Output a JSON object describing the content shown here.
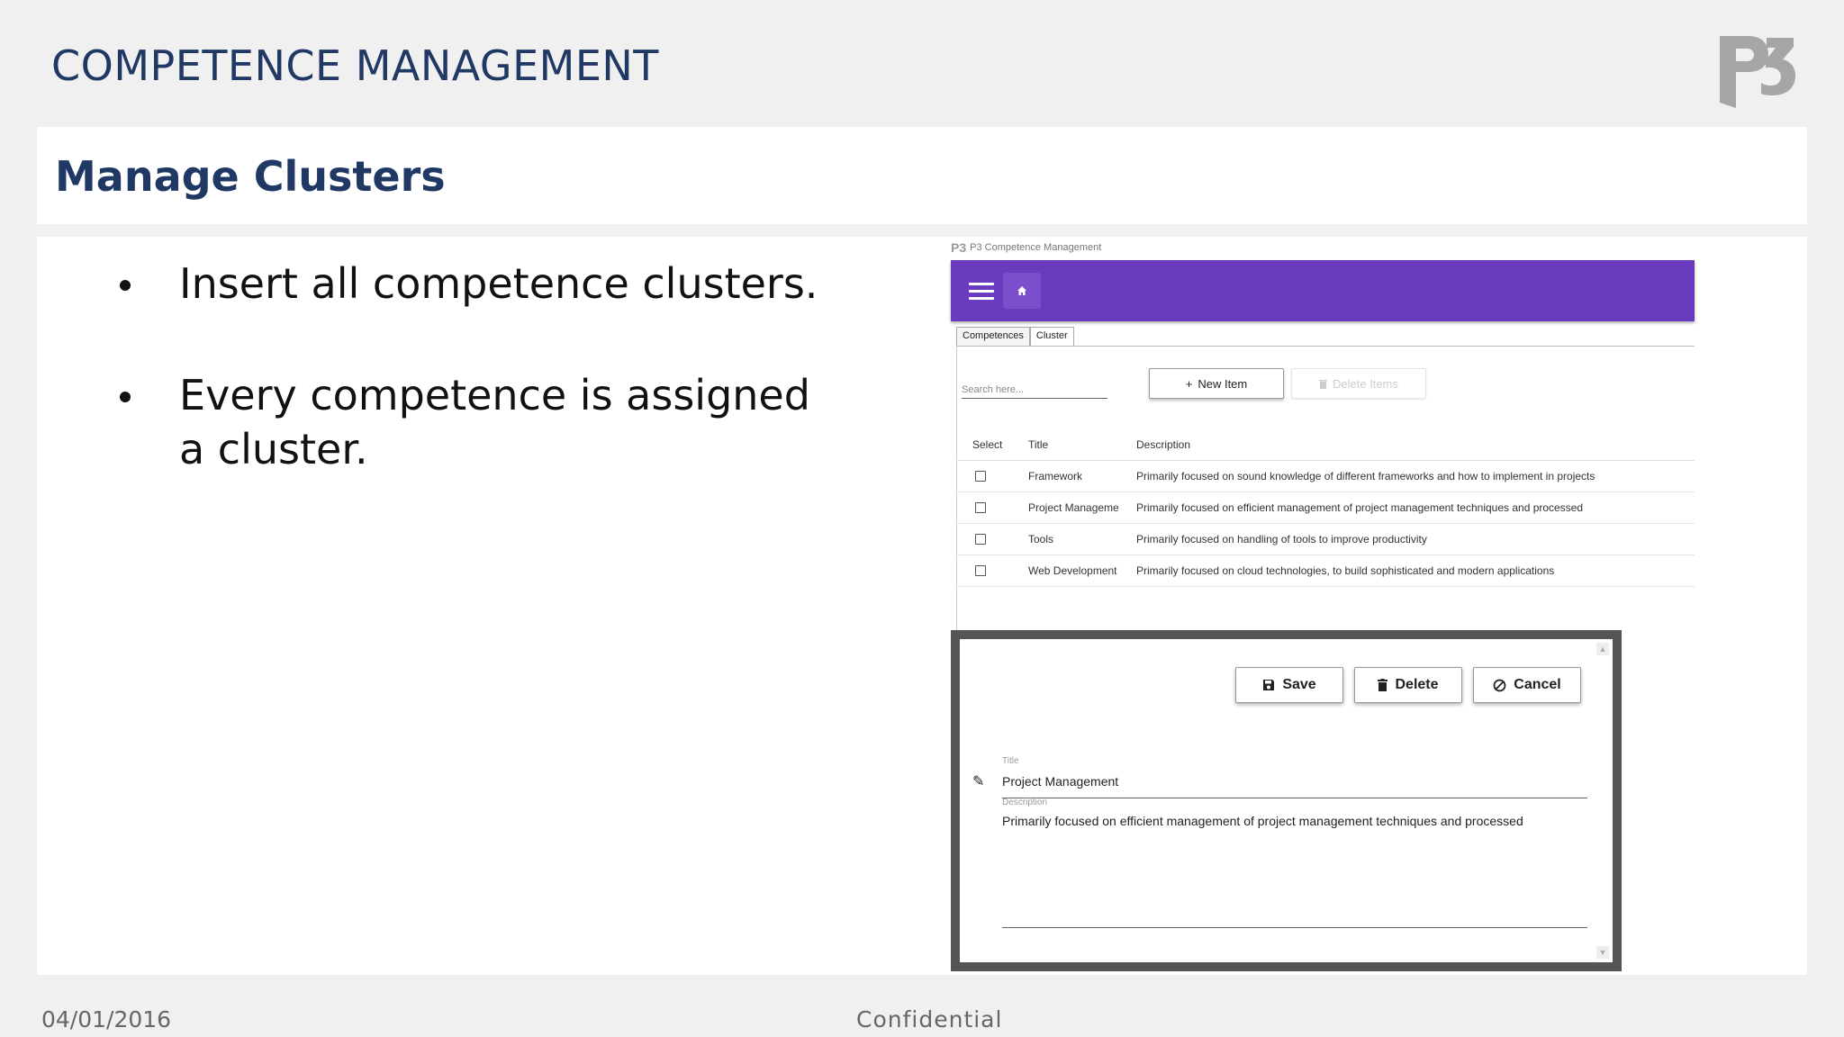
{
  "slide": {
    "title": "COMPETENCE MANAGEMENT",
    "logo_text": "P3",
    "subtitle": "Manage Clusters",
    "bullets": [
      "Insert all competence clusters.",
      "Every competence is assigned a cluster."
    ],
    "footer_date": "04/01/2016",
    "footer_confidential": "Confidential"
  },
  "app": {
    "caption": "P3 Competence Management",
    "caption_logo": "P3",
    "tabs": [
      "Competences",
      "Cluster"
    ],
    "search_placeholder": "Search here...",
    "new_item_label": "New Item",
    "delete_items_label": "Delete Items",
    "columns": [
      "Select",
      "Title",
      "Description"
    ],
    "rows": [
      {
        "title": "Framework",
        "description": "Primarily focused on sound knowledge of different frameworks and how to implement in projects"
      },
      {
        "title": "Project Manageme",
        "description": "Primarily focused on efficient management of project management techniques and processed"
      },
      {
        "title": "Tools",
        "description": "Primarily focused on handling of tools to improve productivity"
      },
      {
        "title": "Web Development",
        "description": "Primarily focused on cloud technologies, to build sophisticated and modern applications"
      }
    ],
    "dialog": {
      "save_label": "Save",
      "delete_label": "Delete",
      "cancel_label": "Cancel",
      "title_label": "Title",
      "title_value": "Project Management",
      "description_label": "Description",
      "description_value": "Primarily focused on efficient management of project management techniques and processed"
    }
  },
  "colors": {
    "appbar": "#6a3bbf",
    "title": "#1f3864"
  }
}
